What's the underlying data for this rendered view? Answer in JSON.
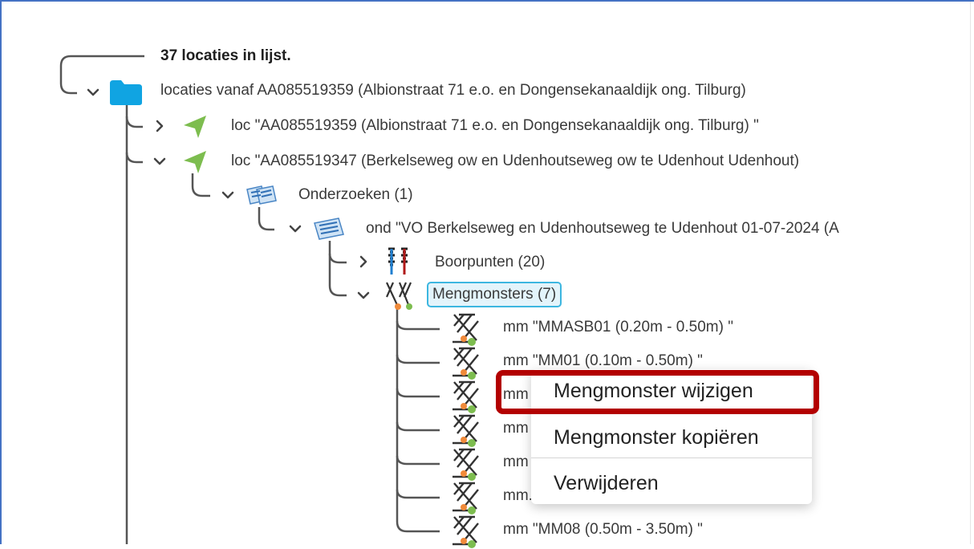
{
  "tree": {
    "count_label": "37 locaties in lijst.",
    "root": {
      "label": "locaties vanaf AA085519359 (Albionstraat 71 e.o. en Dongensekanaaldijk ong. Tilburg)",
      "icon": "folder-icon"
    },
    "loc1": {
      "label": "loc \"AA085519359 (Albionstraat 71 e.o. en Dongensekanaaldijk ong. Tilburg) \"",
      "icon": "location-arrow-icon"
    },
    "loc2": {
      "label": "loc \"AA085519347 (Berkelseweg ow en Udenhoutseweg ow te Udenhout Udenhout)",
      "icon": "location-arrow-icon"
    },
    "onderzoeken": {
      "label": "Onderzoeken (1)",
      "icon": "documents-stack-icon"
    },
    "ond": {
      "label": "ond \"VO Berkelseweg en Udenhoutseweg te Udenhout 01-07-2024 (A",
      "icon": "document-icon"
    },
    "boorpunten": {
      "label": "Boorpunten (20)",
      "icon": "drill-points-icon"
    },
    "mengmonsters": {
      "label": "Mengmonsters (7)",
      "icon": "mixed-samples-icon"
    },
    "samples": [
      {
        "label": "mm \"MMASB01 (0.20m - 0.50m) \""
      },
      {
        "label": "mm \"MM01 (0.10m - 0.50m) \""
      },
      {
        "label": "mm"
      },
      {
        "label": "mm"
      },
      {
        "label": "mm"
      },
      {
        "label": "mm."
      },
      {
        "label": "mm \"MM08 (0.50m - 3.50m) \""
      }
    ]
  },
  "context_menu": {
    "items": [
      "Mengmonster wijzigen",
      "Mengmonster kopiëren",
      "Verwijderen"
    ]
  },
  "colors": {
    "accent": "#3cb6e0",
    "highlight": "#b30000",
    "folder": "#10a4e2",
    "arrow": "#7dbd4f"
  }
}
